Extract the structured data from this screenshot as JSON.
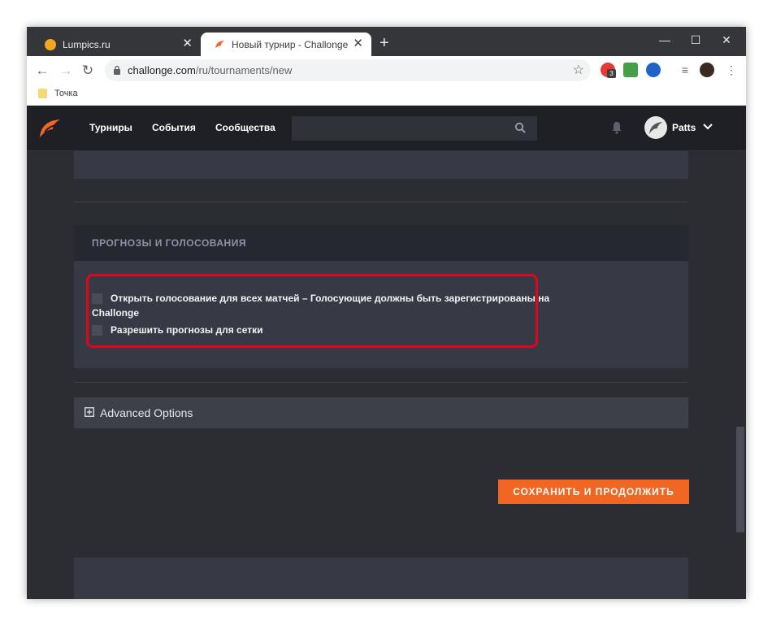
{
  "browser": {
    "tabs": [
      {
        "title": "Lumpics.ru",
        "active": false,
        "favicon_color": "#f5a623"
      },
      {
        "title": "Новый турнир - Challonge",
        "active": true,
        "favicon_color": "#f26623"
      }
    ],
    "new_tab_label": "+",
    "window_controls": {
      "minimize": "—",
      "maximize": "☐",
      "close": "✕"
    },
    "url": {
      "domain": "challonge.com",
      "path": "/ru/tournaments/new"
    },
    "extension_badge": "3",
    "bookmarks": [
      {
        "label": "Точка"
      }
    ]
  },
  "site": {
    "nav": [
      "Турниры",
      "События",
      "Сообщества"
    ],
    "search_placeholder": "",
    "username": "Patts",
    "brand_color": "#f26623"
  },
  "predictions_section": {
    "title": "ПРОГНОЗЫ И ГОЛОСОВАНИЯ",
    "options": [
      {
        "label_line1": "Открыть голосование для всех матчей – Голосующие должны быть зарегистрированы на",
        "label_line2": "Challonge",
        "checked": false
      },
      {
        "label_line1": "Разрешить прогнозы для сетки",
        "checked": false
      }
    ]
  },
  "advanced": {
    "label": "Advanced Options"
  },
  "save_button": {
    "label": "СОХРАНИТЬ И ПРОДОЛЖИТЬ"
  }
}
